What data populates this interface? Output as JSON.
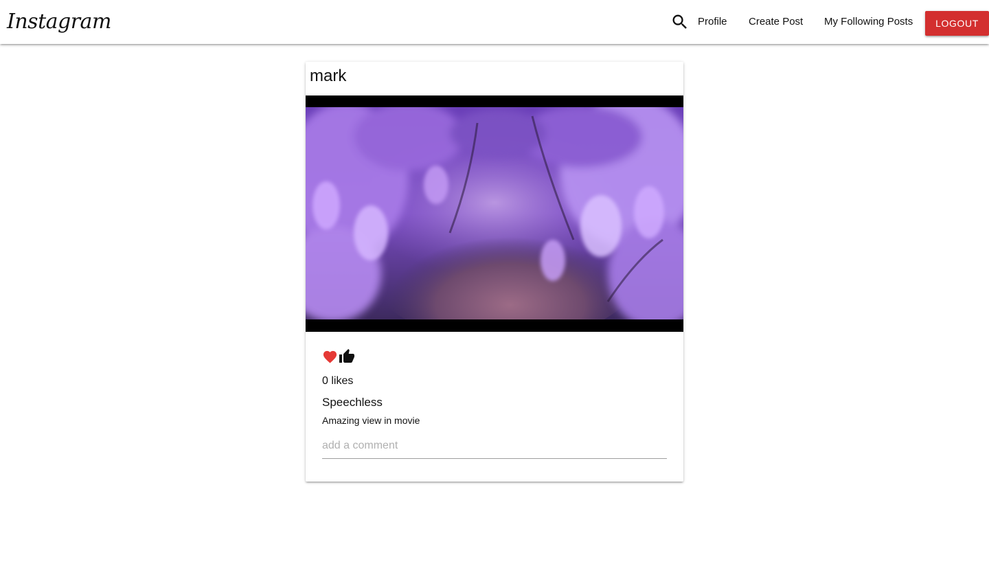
{
  "nav": {
    "brand": "Instagram",
    "links": {
      "profile": "Profile",
      "create_post": "Create Post",
      "following_posts": "My Following Posts"
    },
    "logout_label": "LOGOUT",
    "search_icon": "search-icon",
    "logout_color": "#d32f2f"
  },
  "post": {
    "author": "mark",
    "image_alt_icon": "wisteria-photo",
    "actions": {
      "like_icon": "heart-icon",
      "like_color": "#e53935",
      "thumb_icon": "thumbs-up-icon"
    },
    "likes_text": "0 likes",
    "title": "Speechless",
    "body": "Amazing view in movie",
    "comment_placeholder": "add a comment"
  }
}
